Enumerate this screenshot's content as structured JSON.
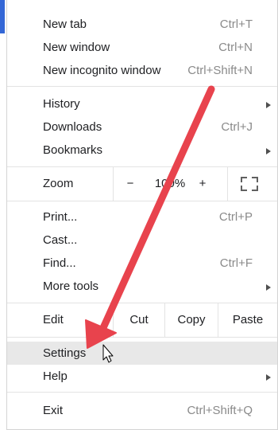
{
  "menu": {
    "group1": [
      {
        "label": "New tab",
        "shortcut": "Ctrl+T"
      },
      {
        "label": "New window",
        "shortcut": "Ctrl+N"
      },
      {
        "label": "New incognito window",
        "shortcut": "Ctrl+Shift+N"
      }
    ],
    "group2": [
      {
        "label": "History",
        "shortcut": ""
      },
      {
        "label": "Downloads",
        "shortcut": "Ctrl+J"
      },
      {
        "label": "Bookmarks",
        "shortcut": ""
      }
    ],
    "zoom": {
      "label": "Zoom",
      "minus": "−",
      "value": "100%",
      "plus": "+",
      "fullscreen_icon": "fullscreen-icon"
    },
    "group3": [
      {
        "label": "Print...",
        "shortcut": "Ctrl+P"
      },
      {
        "label": "Cast...",
        "shortcut": ""
      },
      {
        "label": "Find...",
        "shortcut": "Ctrl+F"
      },
      {
        "label": "More tools",
        "shortcut": ""
      }
    ],
    "edit": {
      "label": "Edit",
      "cut": "Cut",
      "copy": "Copy",
      "paste": "Paste"
    },
    "group4": [
      {
        "label": "Settings",
        "shortcut": ""
      },
      {
        "label": "Help",
        "shortcut": ""
      }
    ],
    "group5": [
      {
        "label": "Exit",
        "shortcut": "Ctrl+Shift+Q"
      }
    ]
  },
  "annotation": {
    "arrow_color": "#e8434d",
    "arrow_icon": "red-arrow-annotation",
    "cursor_icon": "mouse-pointer-icon"
  },
  "colors": {
    "highlight": "#e8e8e8",
    "shortcut_text": "#8a8a8a",
    "window_accent": "#3367d6"
  }
}
